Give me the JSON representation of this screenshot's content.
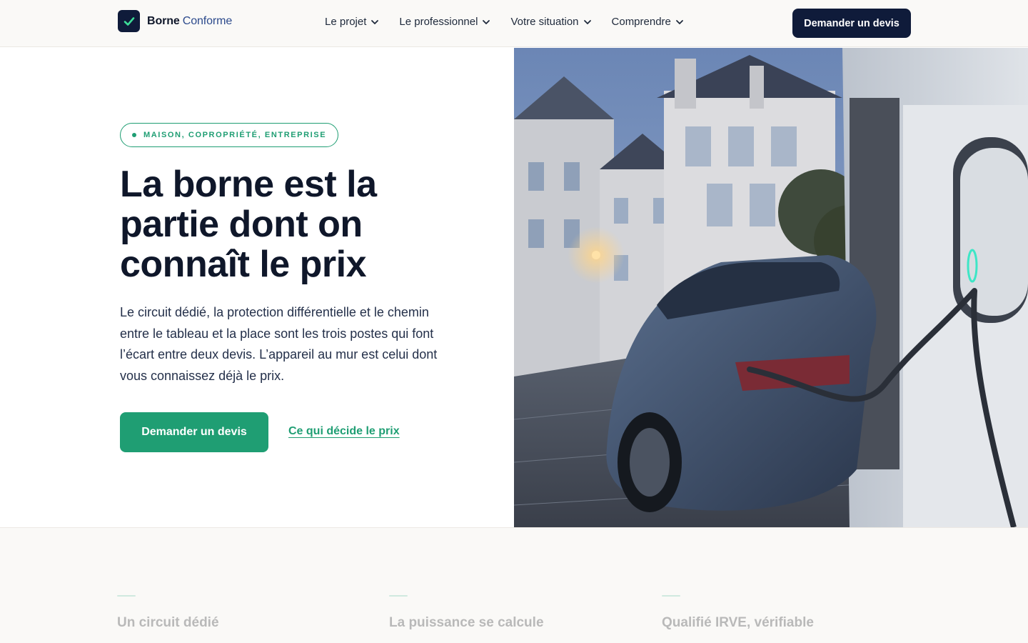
{
  "brand": {
    "name_main": "Borne",
    "name_accent": "Conforme",
    "mark_color": "#0f1b3a",
    "accent_color": "#1f9e73"
  },
  "nav": {
    "items": [
      {
        "label": "Le projet",
        "icon": "chevron-down-icon"
      },
      {
        "label": "Le professionnel",
        "icon": "chevron-down-icon"
      },
      {
        "label": "Votre situation",
        "icon": "chevron-down-icon"
      },
      {
        "label": "Comprendre",
        "icon": "chevron-down-icon"
      }
    ],
    "cta_label": "Demander un devis"
  },
  "hero": {
    "badge": "MAISON, COPROPRIÉTÉ, ENTREPRISE",
    "title": "La borne est la partie dont on connaît le prix",
    "lead": "Le circuit dédié, la protection différentielle et le chemin entre le tableau et la place sont les trois postes qui font l’écart entre deux devis. L’appareil au mur est celui dont vous connaissez déjà le prix.",
    "primary_cta": "Demander un devis",
    "secondary_cta": "Ce qui décide le prix"
  },
  "features": [
    {
      "title": "Un circuit dédié"
    },
    {
      "title": "La puissance se calcule"
    },
    {
      "title": "Qualifié IRVE, vérifiable"
    }
  ]
}
